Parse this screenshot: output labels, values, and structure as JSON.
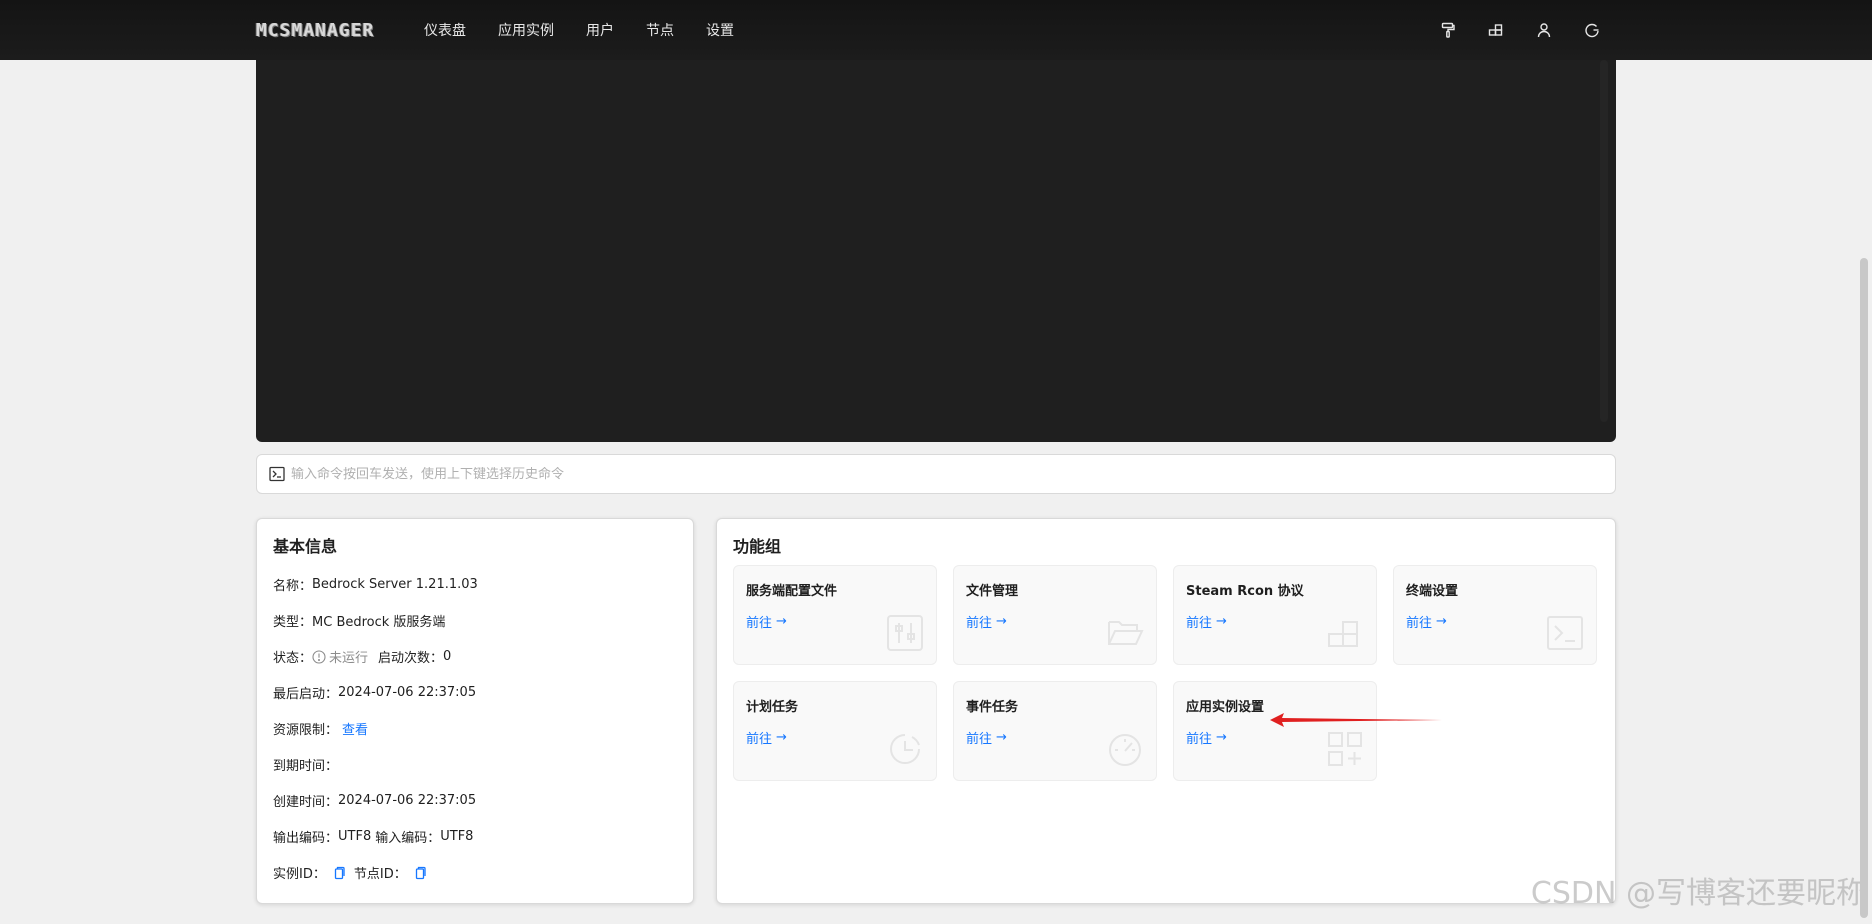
{
  "app": {
    "logo": "MCSMANAGER"
  },
  "nav": {
    "items": [
      {
        "label": "仪表盘"
      },
      {
        "label": "应用实例"
      },
      {
        "label": "用户"
      },
      {
        "label": "节点"
      },
      {
        "label": "设置"
      }
    ]
  },
  "top_icons": [
    "paint-roller-icon",
    "blocks-icon",
    "user-icon",
    "logout-icon"
  ],
  "command": {
    "placeholder": "输入命令按回车发送，使用上下键选择历史命令"
  },
  "info": {
    "title": "基本信息",
    "name_label": "名称：",
    "name_value": "Bedrock Server 1.21.1.03",
    "type_label": "类型：",
    "type_value": "MC Bedrock 版服务端",
    "status_label": "状态：",
    "status_value": "未运行",
    "start_count_label": "启动次数：",
    "start_count_value": "0",
    "last_start_label": "最后启动：",
    "last_start_value": "2024-07-06 22:37:05",
    "resource_label": "资源限制：",
    "resource_link": "查看",
    "expire_label": "到期时间：",
    "created_label": "创建时间：",
    "created_value": "2024-07-06 22:37:05",
    "output_enc_label": "输出编码：",
    "output_enc_value": "UTF8",
    "input_enc_label": "输入编码：",
    "input_enc_value": "UTF8",
    "instance_id_label": "实例ID：",
    "node_id_label": "节点ID："
  },
  "functions": {
    "title": "功能组",
    "goto_label": "前往",
    "cards": [
      {
        "title": "服务端配置文件",
        "icon": "sliders-icon"
      },
      {
        "title": "文件管理",
        "icon": "folder-open-icon"
      },
      {
        "title": "Steam Rcon 协议",
        "icon": "blocks-icon"
      },
      {
        "title": "终端设置",
        "icon": "terminal-icon"
      },
      {
        "title": "计划任务",
        "icon": "clock-icon"
      },
      {
        "title": "事件任务",
        "icon": "dashboard-icon"
      },
      {
        "title": "应用实例设置",
        "icon": "appstore-add-icon"
      }
    ]
  },
  "colors": {
    "accent": "#1677ff",
    "topbar": "#1a1a1a",
    "terminal": "#1f1f1f",
    "annotation_arrow": "#e02020"
  },
  "watermark": "CSDN @写博客还要昵称"
}
